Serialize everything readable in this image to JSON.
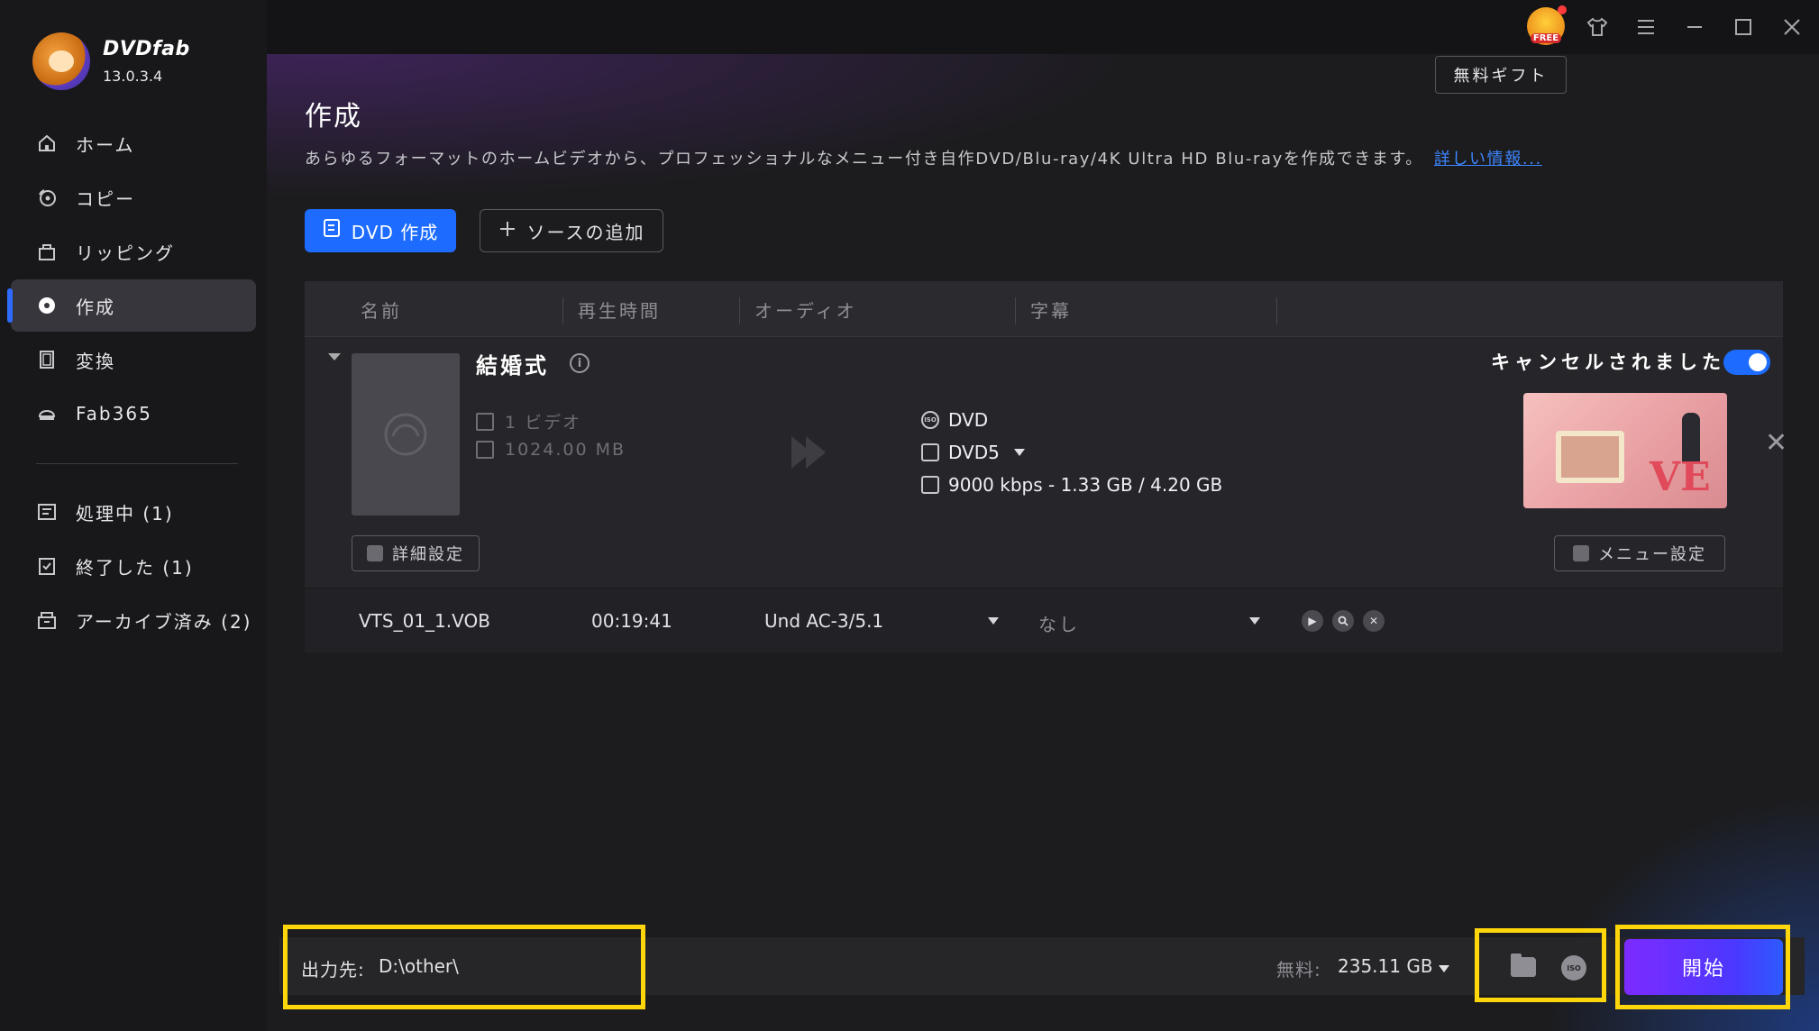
{
  "app": {
    "name": "DVDfab",
    "version": "13.0.3.4"
  },
  "sidebar": {
    "items": [
      {
        "label": "ホーム",
        "icon": "home-icon"
      },
      {
        "label": "コピー",
        "icon": "copy-disc-icon"
      },
      {
        "label": "リッピング",
        "icon": "ripper-icon"
      },
      {
        "label": "作成",
        "icon": "creator-disc-icon",
        "active": true
      },
      {
        "label": "変換",
        "icon": "film-icon"
      },
      {
        "label": "Fab365",
        "icon": "fab365-icon"
      }
    ],
    "queue": [
      {
        "label": "処理中 (1)",
        "icon": "processing-icon"
      },
      {
        "label": "終了した (1)",
        "icon": "finished-icon"
      },
      {
        "label": "アーカイブ済み (2)",
        "icon": "archive-icon"
      }
    ]
  },
  "titlebar": {
    "free_badge": "FREE",
    "gift_button": "無料ギフト"
  },
  "page": {
    "title": "作成",
    "description": "あらゆるフォーマットのホームビデオから、プロフェッショナルなメニュー付き自作DVD/Blu-ray/4K Ultra HD Blu-rayを作成できます。",
    "more_link": "詳しい情報..."
  },
  "toolbar": {
    "create_button": "DVD 作成",
    "add_source_button": "ソースの追加"
  },
  "table": {
    "headers": [
      "名前",
      "再生時間",
      "オーディオ",
      "字幕"
    ],
    "item": {
      "title": "結婚式",
      "video_count": "1 ビデオ",
      "size": "1024.00 MB",
      "output_format": "DVD",
      "disc_type": "DVD5",
      "bitrate_info": "9000 kbps - 1.33 GB / 4.20 GB",
      "status": "キャンセルされました",
      "toggle_on": true,
      "advanced_button": "詳細設定",
      "menu_button": "メニュー設定"
    },
    "track": {
      "name": "VTS_01_1.VOB",
      "duration": "00:19:41",
      "audio": "Und  AC-3/5.1",
      "subtitle": "なし"
    }
  },
  "footer": {
    "output_label": "出力先:",
    "output_path": "D:\\other\\",
    "free_label": "無料:",
    "free_space": "235.11 GB",
    "start_button": "開始"
  },
  "colors": {
    "accent": "#1d6cff",
    "highlight": "#ffd60a",
    "start_gradient_start": "#7d2bff"
  }
}
